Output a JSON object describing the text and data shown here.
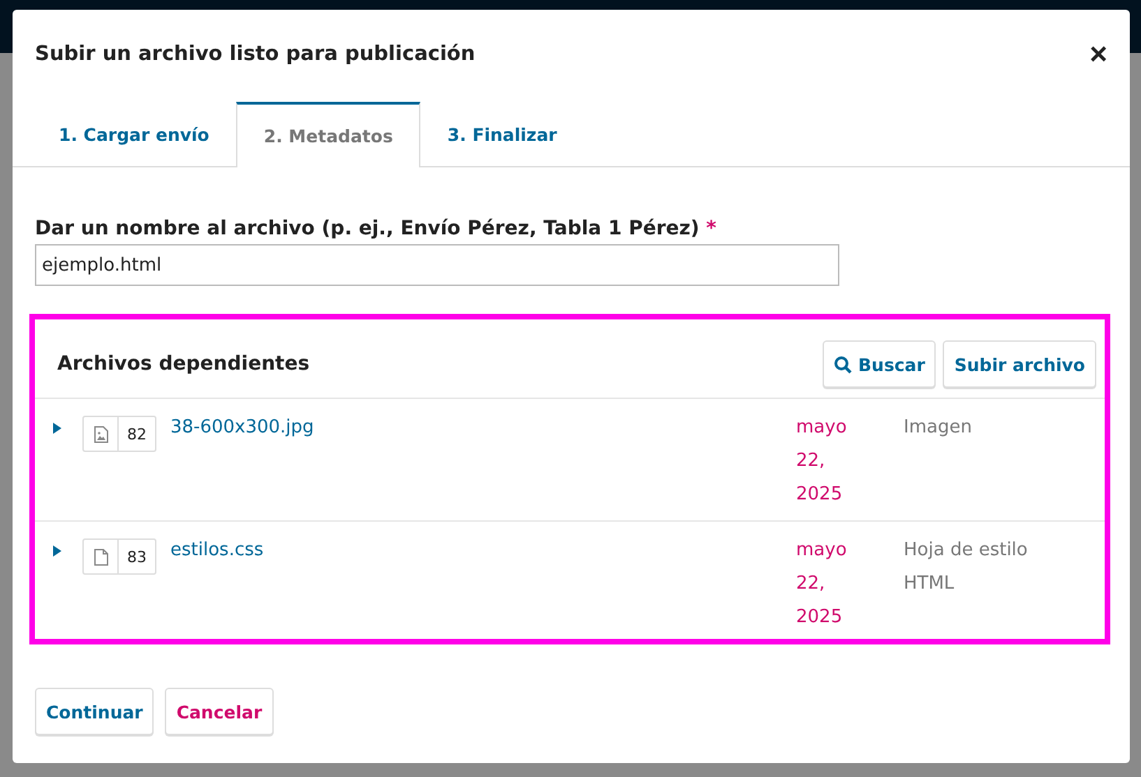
{
  "modal": {
    "title": "Subir un archivo listo para publicación",
    "close": "×"
  },
  "tabs": [
    {
      "label": "1. Cargar envío",
      "selected": false
    },
    {
      "label": "2. Metadatos",
      "selected": true
    },
    {
      "label": "3. Finalizar",
      "selected": false
    }
  ],
  "name_field": {
    "label": "Dar un nombre al archivo (p. ej., Envío Pérez, Tabla 1 Pérez)",
    "required_mark": "*",
    "value": "ejemplo.html"
  },
  "dependent_files": {
    "title": "Archivos dependientes",
    "buttons": [
      {
        "label": "Buscar",
        "kind": "search"
      },
      {
        "label": "Subir archivo",
        "kind": "plain"
      }
    ],
    "rows": [
      {
        "kind": "image",
        "id": "82",
        "name": "38-600x300.jpg",
        "date": [
          "mayo",
          "22,",
          "2025"
        ],
        "type": [
          "Imagen"
        ]
      },
      {
        "kind": "document",
        "id": "83",
        "name": "estilos.css",
        "date": [
          "mayo",
          "22,",
          "2025"
        ],
        "type": [
          "Hoja de estilo",
          "HTML"
        ]
      }
    ]
  },
  "footer": [
    {
      "label": "Continuar",
      "kind": "primary"
    },
    {
      "label": "Cancelar",
      "kind": "cancel"
    }
  ]
}
